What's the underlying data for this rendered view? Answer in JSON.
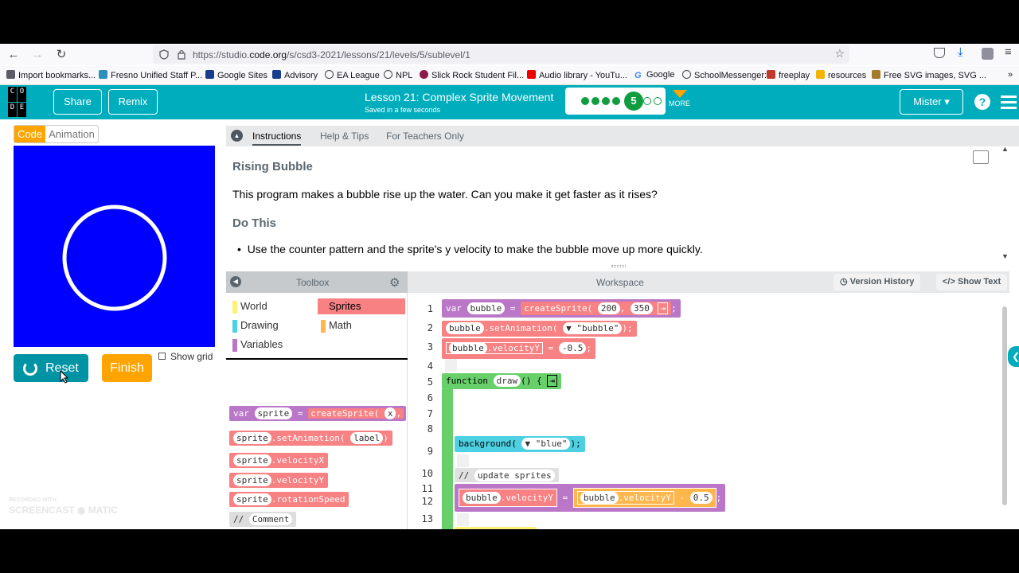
{
  "browser": {
    "url_prefix": "https://studio.",
    "url_domain": "code.org",
    "url_rest": "/s/csd3-2021/lessons/21/levels/5/sublevel/1",
    "bookmarks": [
      "Import bookmarks...",
      "Fresno Unified Staff P...",
      "Google Sites",
      "Advisory",
      "EA League",
      "NPL",
      "Slick Rock Student Fil...",
      "Audio library - YouTu...",
      "Google",
      "SchoolMessenger:",
      "freeplay",
      "resources",
      "Free SVG images, SVG ..."
    ]
  },
  "header": {
    "share": "Share",
    "remix": "Remix",
    "lesson_title": "Lesson 21: Complex Sprite Movement",
    "saved": "Saved in a few seconds",
    "current_level": "5",
    "more": "MORE",
    "user": "Mister",
    "logo_letters": [
      "C",
      "O",
      "",
      "D",
      "E",
      ""
    ]
  },
  "left": {
    "tab_code": "Code",
    "tab_animation": "Animation",
    "reset": "Reset",
    "finish": "Finish",
    "show_grid": "Show grid",
    "watermark_small": "RECORDED WITH",
    "watermark": "SCREENCAST ◉ MATIC"
  },
  "instructions": {
    "tabs": [
      "Instructions",
      "Help & Tips",
      "For Teachers Only"
    ],
    "title": "Rising Bubble",
    "description": "This program makes a bubble rise up the water. Can you make it get faster as it rises?",
    "do_this": "Do This",
    "task": "Use the counter pattern and the sprite's y velocity to make the bubble move up more quickly."
  },
  "toolbox": {
    "title": "Toolbox",
    "categories": [
      "World",
      "Sprites",
      "Drawing",
      "Math",
      "Variables"
    ],
    "category_colors": [
      "#fff176",
      "#f78183",
      "#4dd0e1",
      "#ffb74d",
      "#bb77c7"
    ]
  },
  "workspace": {
    "title": "Workspace",
    "version_history": "Version History",
    "show_text": "Show Text",
    "line_numbers": [
      "1",
      "2",
      "3",
      "4",
      "5",
      "6",
      "7",
      "8",
      "9",
      "10",
      "11",
      "12",
      "13"
    ]
  }
}
